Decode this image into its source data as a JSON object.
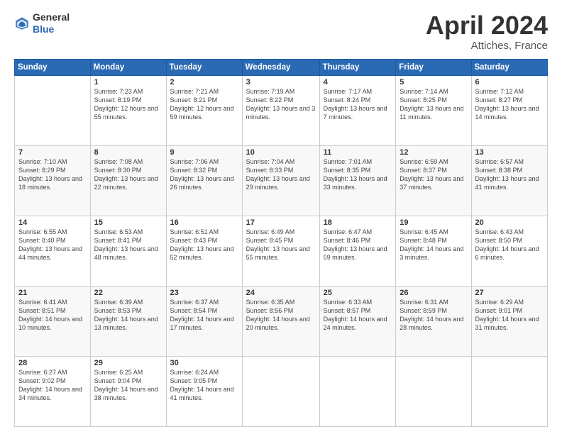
{
  "logo": {
    "line1": "General",
    "line2": "Blue"
  },
  "title": "April 2024",
  "location": "Attiches, France",
  "days_header": [
    "Sunday",
    "Monday",
    "Tuesday",
    "Wednesday",
    "Thursday",
    "Friday",
    "Saturday"
  ],
  "weeks": [
    [
      {
        "num": "",
        "sunrise": "",
        "sunset": "",
        "daylight": ""
      },
      {
        "num": "1",
        "sunrise": "Sunrise: 7:23 AM",
        "sunset": "Sunset: 8:19 PM",
        "daylight": "Daylight: 12 hours and 55 minutes."
      },
      {
        "num": "2",
        "sunrise": "Sunrise: 7:21 AM",
        "sunset": "Sunset: 8:21 PM",
        "daylight": "Daylight: 12 hours and 59 minutes."
      },
      {
        "num": "3",
        "sunrise": "Sunrise: 7:19 AM",
        "sunset": "Sunset: 8:22 PM",
        "daylight": "Daylight: 13 hours and 3 minutes."
      },
      {
        "num": "4",
        "sunrise": "Sunrise: 7:17 AM",
        "sunset": "Sunset: 8:24 PM",
        "daylight": "Daylight: 13 hours and 7 minutes."
      },
      {
        "num": "5",
        "sunrise": "Sunrise: 7:14 AM",
        "sunset": "Sunset: 8:25 PM",
        "daylight": "Daylight: 13 hours and 11 minutes."
      },
      {
        "num": "6",
        "sunrise": "Sunrise: 7:12 AM",
        "sunset": "Sunset: 8:27 PM",
        "daylight": "Daylight: 13 hours and 14 minutes."
      }
    ],
    [
      {
        "num": "7",
        "sunrise": "Sunrise: 7:10 AM",
        "sunset": "Sunset: 8:29 PM",
        "daylight": "Daylight: 13 hours and 18 minutes."
      },
      {
        "num": "8",
        "sunrise": "Sunrise: 7:08 AM",
        "sunset": "Sunset: 8:30 PM",
        "daylight": "Daylight: 13 hours and 22 minutes."
      },
      {
        "num": "9",
        "sunrise": "Sunrise: 7:06 AM",
        "sunset": "Sunset: 8:32 PM",
        "daylight": "Daylight: 13 hours and 26 minutes."
      },
      {
        "num": "10",
        "sunrise": "Sunrise: 7:04 AM",
        "sunset": "Sunset: 8:33 PM",
        "daylight": "Daylight: 13 hours and 29 minutes."
      },
      {
        "num": "11",
        "sunrise": "Sunrise: 7:01 AM",
        "sunset": "Sunset: 8:35 PM",
        "daylight": "Daylight: 13 hours and 33 minutes."
      },
      {
        "num": "12",
        "sunrise": "Sunrise: 6:59 AM",
        "sunset": "Sunset: 8:37 PM",
        "daylight": "Daylight: 13 hours and 37 minutes."
      },
      {
        "num": "13",
        "sunrise": "Sunrise: 6:57 AM",
        "sunset": "Sunset: 8:38 PM",
        "daylight": "Daylight: 13 hours and 41 minutes."
      }
    ],
    [
      {
        "num": "14",
        "sunrise": "Sunrise: 6:55 AM",
        "sunset": "Sunset: 8:40 PM",
        "daylight": "Daylight: 13 hours and 44 minutes."
      },
      {
        "num": "15",
        "sunrise": "Sunrise: 6:53 AM",
        "sunset": "Sunset: 8:41 PM",
        "daylight": "Daylight: 13 hours and 48 minutes."
      },
      {
        "num": "16",
        "sunrise": "Sunrise: 6:51 AM",
        "sunset": "Sunset: 8:43 PM",
        "daylight": "Daylight: 13 hours and 52 minutes."
      },
      {
        "num": "17",
        "sunrise": "Sunrise: 6:49 AM",
        "sunset": "Sunset: 8:45 PM",
        "daylight": "Daylight: 13 hours and 55 minutes."
      },
      {
        "num": "18",
        "sunrise": "Sunrise: 6:47 AM",
        "sunset": "Sunset: 8:46 PM",
        "daylight": "Daylight: 13 hours and 59 minutes."
      },
      {
        "num": "19",
        "sunrise": "Sunrise: 6:45 AM",
        "sunset": "Sunset: 8:48 PM",
        "daylight": "Daylight: 14 hours and 3 minutes."
      },
      {
        "num": "20",
        "sunrise": "Sunrise: 6:43 AM",
        "sunset": "Sunset: 8:50 PM",
        "daylight": "Daylight: 14 hours and 6 minutes."
      }
    ],
    [
      {
        "num": "21",
        "sunrise": "Sunrise: 6:41 AM",
        "sunset": "Sunset: 8:51 PM",
        "daylight": "Daylight: 14 hours and 10 minutes."
      },
      {
        "num": "22",
        "sunrise": "Sunrise: 6:39 AM",
        "sunset": "Sunset: 8:53 PM",
        "daylight": "Daylight: 14 hours and 13 minutes."
      },
      {
        "num": "23",
        "sunrise": "Sunrise: 6:37 AM",
        "sunset": "Sunset: 8:54 PM",
        "daylight": "Daylight: 14 hours and 17 minutes."
      },
      {
        "num": "24",
        "sunrise": "Sunrise: 6:35 AM",
        "sunset": "Sunset: 8:56 PM",
        "daylight": "Daylight: 14 hours and 20 minutes."
      },
      {
        "num": "25",
        "sunrise": "Sunrise: 6:33 AM",
        "sunset": "Sunset: 8:57 PM",
        "daylight": "Daylight: 14 hours and 24 minutes."
      },
      {
        "num": "26",
        "sunrise": "Sunrise: 6:31 AM",
        "sunset": "Sunset: 8:59 PM",
        "daylight": "Daylight: 14 hours and 28 minutes."
      },
      {
        "num": "27",
        "sunrise": "Sunrise: 6:29 AM",
        "sunset": "Sunset: 9:01 PM",
        "daylight": "Daylight: 14 hours and 31 minutes."
      }
    ],
    [
      {
        "num": "28",
        "sunrise": "Sunrise: 6:27 AM",
        "sunset": "Sunset: 9:02 PM",
        "daylight": "Daylight: 14 hours and 34 minutes."
      },
      {
        "num": "29",
        "sunrise": "Sunrise: 6:25 AM",
        "sunset": "Sunset: 9:04 PM",
        "daylight": "Daylight: 14 hours and 38 minutes."
      },
      {
        "num": "30",
        "sunrise": "Sunrise: 6:24 AM",
        "sunset": "Sunset: 9:05 PM",
        "daylight": "Daylight: 14 hours and 41 minutes."
      },
      {
        "num": "",
        "sunrise": "",
        "sunset": "",
        "daylight": ""
      },
      {
        "num": "",
        "sunrise": "",
        "sunset": "",
        "daylight": ""
      },
      {
        "num": "",
        "sunrise": "",
        "sunset": "",
        "daylight": ""
      },
      {
        "num": "",
        "sunrise": "",
        "sunset": "",
        "daylight": ""
      }
    ]
  ]
}
